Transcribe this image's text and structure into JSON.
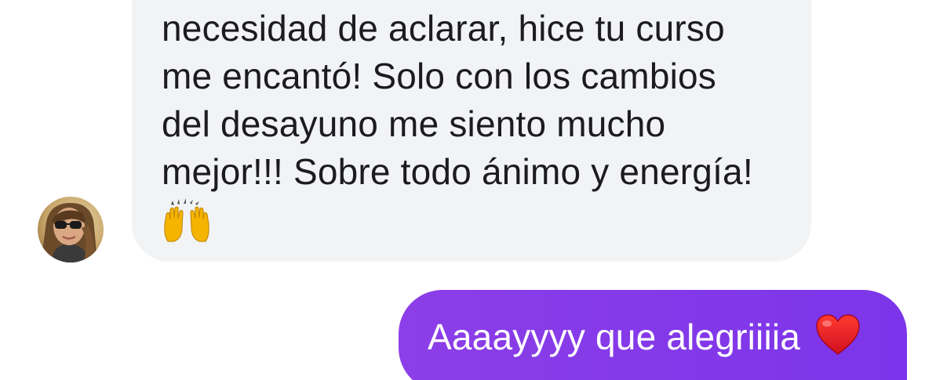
{
  "conversation": {
    "incoming": {
      "lines": [
        "necesidad de aclarar, hice tu curso",
        "me encantó! Solo con los cambios",
        "del desayuno me siento mucho",
        "mejor!!! Sobre todo ánimo y energía!"
      ],
      "emoji": "raising-hands-icon",
      "bubble_color": "#f2f3f5",
      "text_color": "#1c1c1e"
    },
    "outgoing": {
      "text": "Aaaayyyy que alegriiiia",
      "emoji": "red-heart-icon",
      "bubble_color": "#8c3ee8",
      "text_color": "#ffffff"
    },
    "sender_avatar": "avatar"
  }
}
